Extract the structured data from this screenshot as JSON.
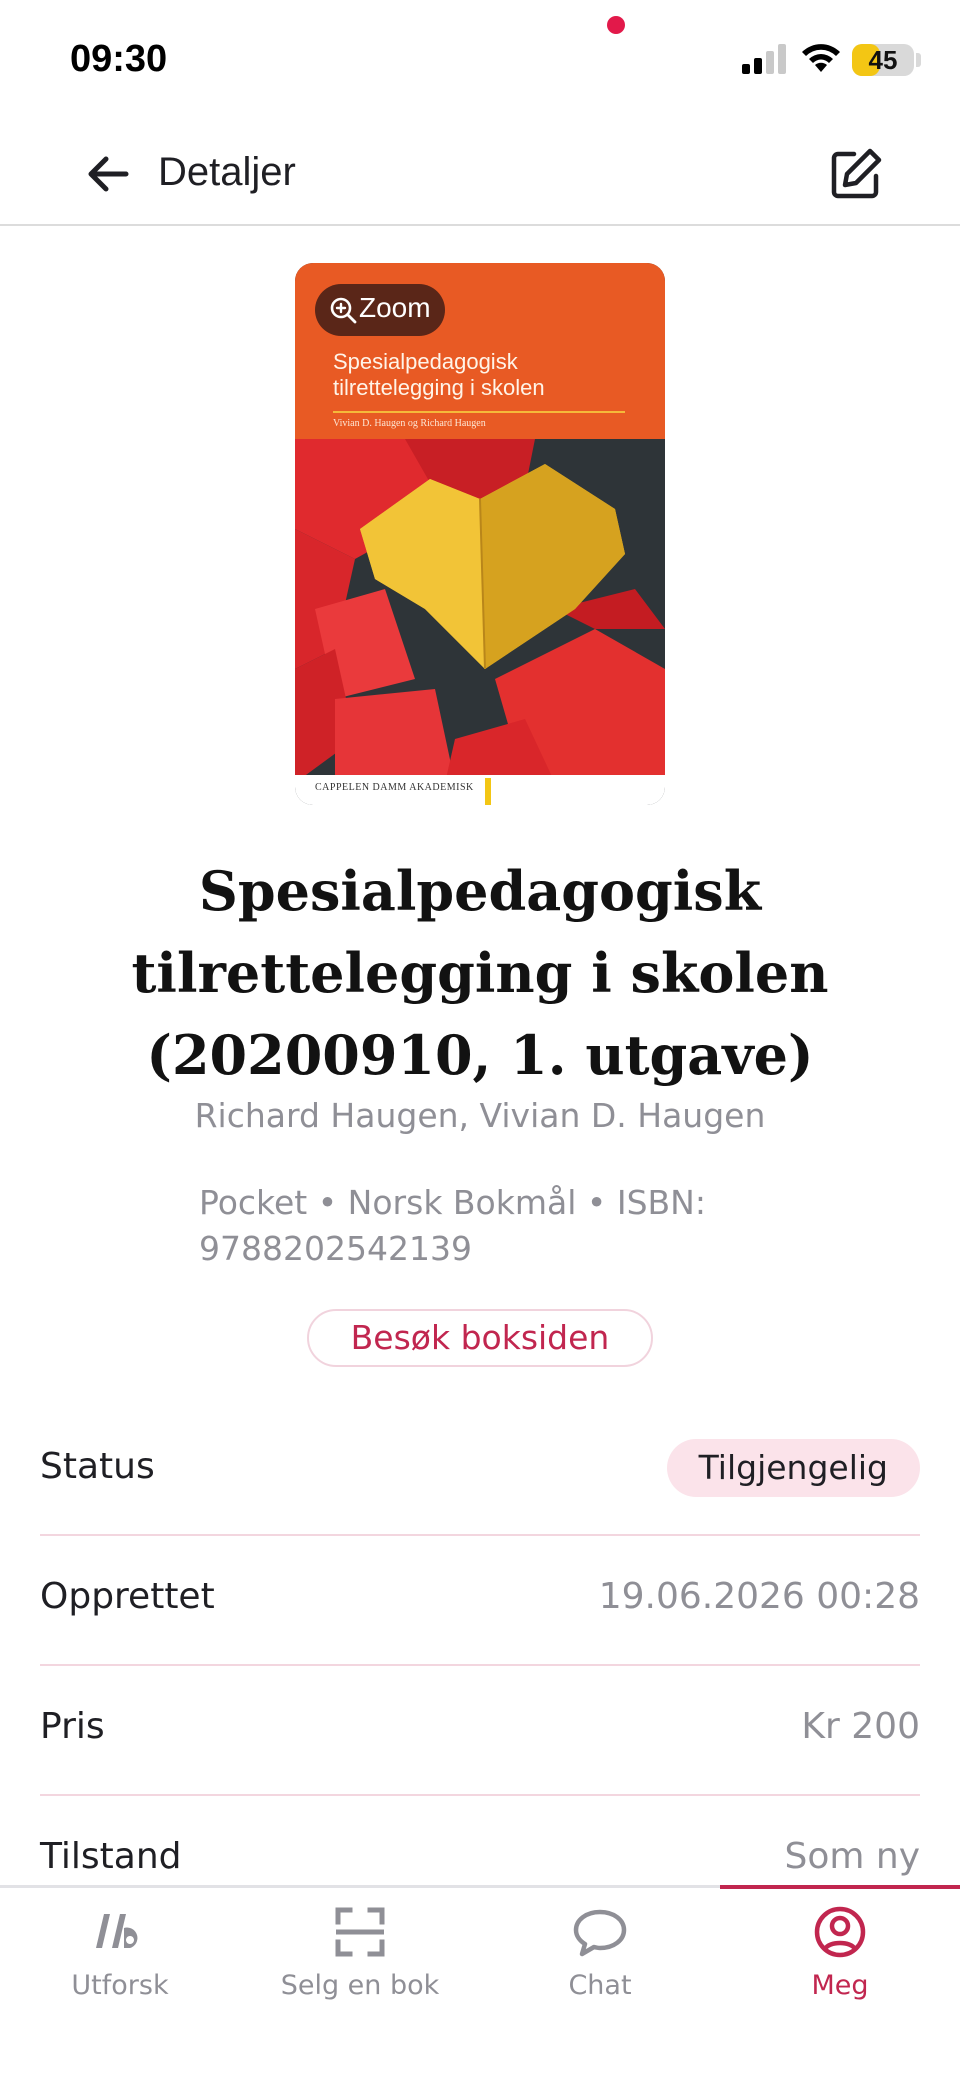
{
  "status_bar": {
    "time": "09:30",
    "battery": "45",
    "battery_level_percent": 45
  },
  "header": {
    "title": "Detaljer",
    "back_icon": "arrow-left-icon",
    "edit_icon": "edit-icon"
  },
  "cover": {
    "zoom_label": "Zoom",
    "title_line1": "Spesialpedagogisk",
    "title_line2": "tilrettelegging i skolen",
    "authors": "Vivian D. Haugen og Richard Haugen",
    "publisher": "CAPPELEN DAMM AKADEMISK"
  },
  "book": {
    "title": "Spesialpedagogisk tilrettelegging i skolen (20200910, 1. utgave)",
    "authors": "Richard Haugen, Vivian D. Haugen",
    "meta": "Pocket • Norsk Bokmål • ISBN: 9788202542139",
    "visit_button": "Besøk boksiden"
  },
  "details": {
    "status_label": "Status",
    "status_value": "Tilgjengelig",
    "created_label": "Opprettet",
    "created_value": "19.06.2026 00:28",
    "price_label": "Pris",
    "price_value": "Kr 200",
    "condition_label": "Tilstand",
    "condition_value": "Som ny"
  },
  "nav": {
    "items": [
      {
        "label": "Utforsk",
        "icon": "explore-icon"
      },
      {
        "label": "Selg en bok",
        "icon": "scan-icon"
      },
      {
        "label": "Chat",
        "icon": "chat-icon"
      },
      {
        "label": "Meg",
        "icon": "profile-icon"
      }
    ],
    "active": "Meg"
  },
  "colors": {
    "accent": "#c1264f",
    "badge_bg": "#fbe3ea",
    "cover_orange": "#e85a24",
    "muted_text": "#8f8f96"
  }
}
